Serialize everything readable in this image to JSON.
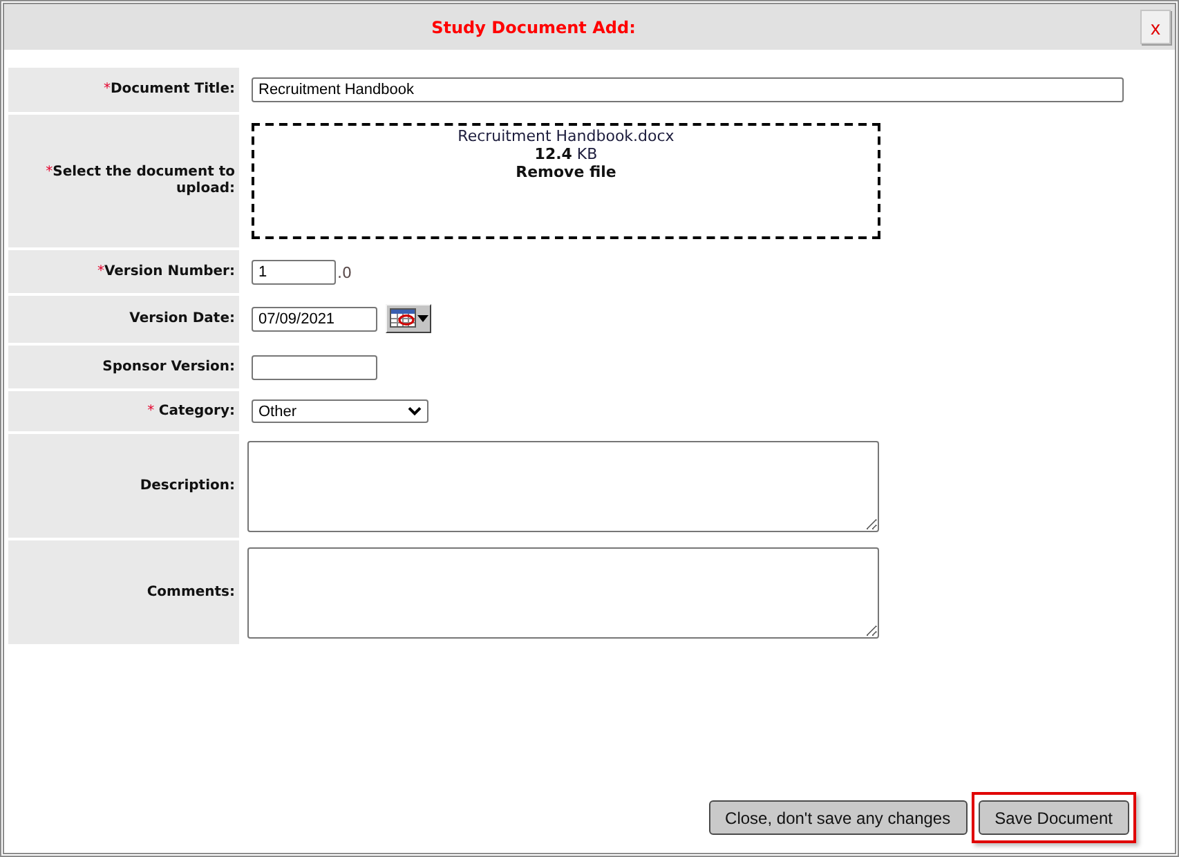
{
  "window": {
    "title": "Study Document Add:",
    "close_button": "x"
  },
  "fields": [
    {
      "label": "Document Title:",
      "required_mark": "*",
      "kind": "line",
      "value": "Recruitment Handbook"
    },
    {
      "label": "Select the document to upload:",
      "required_mark": "*",
      "kind": "upload",
      "file_name": "Recruitment Handbook.docx",
      "size": "**12.4** KB",
      "remove": "Remove file"
    },
    {
      "label": "Version Number:",
      "required_mark": "*",
      "kind": "version",
      "value": "1",
      "suffix": ".0"
    },
    {
      "label": "Version Date:",
      "kind": "date",
      "value": "07/09/2021"
    },
    {
      "label": "Sponsor Version:",
      "kind": "short"
    },
    {
      "label": "Category:",
      "required_mark": "* ",
      "kind": "select",
      "value": "Other"
    },
    {
      "label": "Description:",
      "kind": "textarea"
    },
    {
      "label": "Comments:",
      "kind": "textarea"
    }
  ],
  "buttons": [
    {
      "label": "Close, don't save any changes",
      "highlighted": false
    },
    {
      "label": "Save Document",
      "highlighted": true
    }
  ]
}
